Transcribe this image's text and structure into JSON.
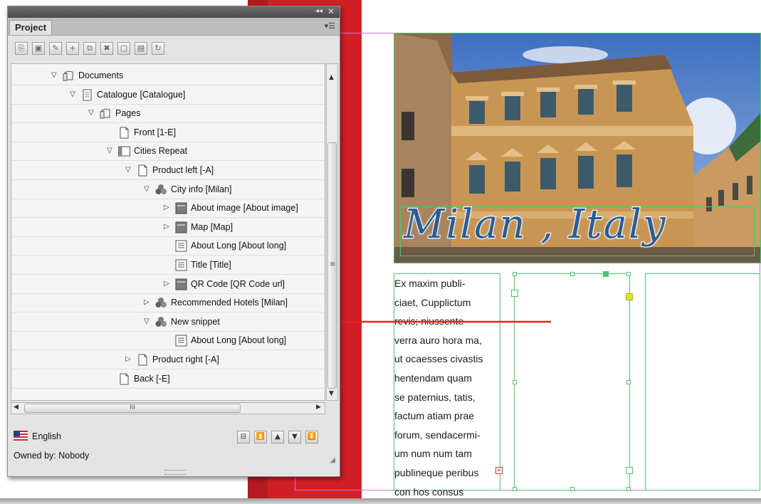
{
  "panel": {
    "tab_label": "Project",
    "collapse_glyph": "◂◂",
    "close_glyph": "✕",
    "menu_glyph": "▾☰",
    "toolbar_icons": [
      "open-icon",
      "save-icon",
      "check-in-icon",
      "add-icon",
      "duplicate-icon",
      "delete-icon",
      "new-document-icon",
      "preview-icon",
      "refresh-icon"
    ],
    "tree": [
      {
        "label": "Documents",
        "icon": "folder-icon",
        "expanded": true
      },
      {
        "label": "Catalogue [Catalogue]",
        "icon": "document-icon",
        "expanded": true
      },
      {
        "label": "Pages",
        "icon": "folder-icon",
        "expanded": true
      },
      {
        "label": "Front [1-E]",
        "icon": "page-icon"
      },
      {
        "label": "Cities Repeat",
        "icon": "repeat-icon",
        "expanded": true
      },
      {
        "label": "Product left [-A]",
        "icon": "page-icon",
        "expanded": true
      },
      {
        "label": "City info [Milan]",
        "icon": "snippet-icon",
        "expanded": true
      },
      {
        "label": "About image [About image]",
        "icon": "image-frame-icon",
        "expanded": false
      },
      {
        "label": "Map [Map]",
        "icon": "image-frame-icon",
        "expanded": false
      },
      {
        "label": "About Long [About long]",
        "icon": "text-frame-icon"
      },
      {
        "label": "Title [Title]",
        "icon": "text-frame-icon"
      },
      {
        "label": "QR Code [QR Code url]",
        "icon": "image-frame-icon",
        "expanded": false
      },
      {
        "label": "Recommended Hotels [Milan]",
        "icon": "snippet-icon",
        "expanded": false
      },
      {
        "label": "New snippet",
        "icon": "snippet-icon",
        "expanded": true
      },
      {
        "label": "About Long [About long]",
        "icon": "text-frame-icon"
      },
      {
        "label": "Product right [-A]",
        "icon": "page-icon",
        "expanded": false
      },
      {
        "label": "Back [-E]",
        "icon": "page-icon"
      }
    ],
    "hscroll_grip": "III",
    "language": "English",
    "owner": "Owned by: Nobody",
    "nav_icons": [
      "tree-view-icon",
      "move-top-icon",
      "move-up-icon",
      "move-down-icon",
      "move-bottom-icon"
    ]
  },
  "document": {
    "city_title": "Milan , Italy",
    "body_lines": [
      "Ex maxim publi-",
      "ciaet, Cupplictum",
      "revis; niussente",
      "verra auro hora ma,",
      "ut ocaesses civastis",
      "hentendam quam",
      "se paternius, tatis,",
      "factum atiam prae",
      "forum, sendacermi-",
      "um num num tam",
      "publineque peribus",
      "con hos consus"
    ],
    "overset_glyph": "+"
  },
  "colors": {
    "frame_edge": "#4fc46b",
    "page_edge": "#c879d6",
    "arrow": "#e8231f",
    "background_red": "#d21f26"
  }
}
